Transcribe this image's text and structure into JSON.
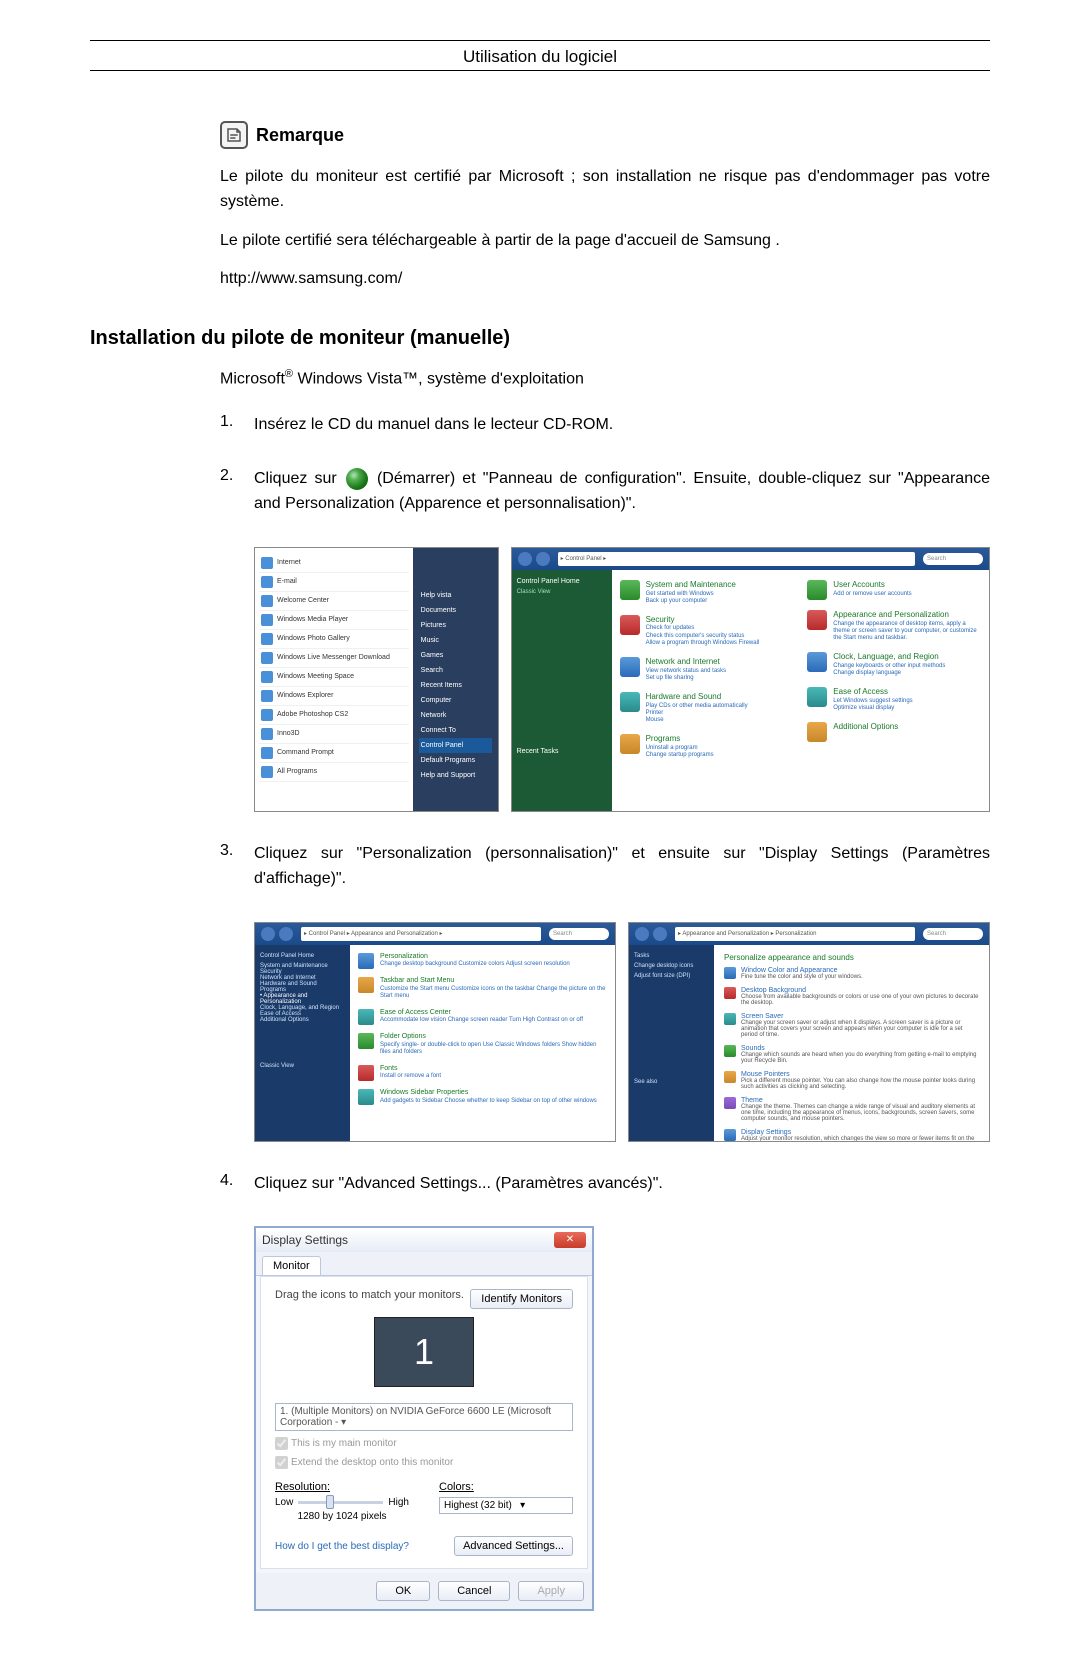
{
  "page_header": "Utilisation du logiciel",
  "remark": {
    "title": "Remarque",
    "para1": "Le pilote du moniteur est certifié par Microsoft ; son installation ne risque pas d'endommager pas votre système.",
    "para2": "Le pilote certifié sera téléchargeable à partir de la page d'accueil de Samsung .",
    "url": "http://www.samsung.com/"
  },
  "section_heading": "Installation du pilote de moniteur (manuelle)",
  "os_line_prefix": "Microsoft",
  "os_line_mid": " Windows Vista",
  "os_line_suffix": ", système d'exploitation",
  "steps": {
    "1": {
      "num": "1.",
      "text": "Insérez le CD du manuel dans le lecteur CD-ROM."
    },
    "2": {
      "num": "2.",
      "pre": "Cliquez sur",
      "post": "(Démarrer) et \"Panneau de configuration\". Ensuite, double-cliquez sur \"Appearance and Personalization (Apparence et personnalisation)\"."
    },
    "3": {
      "num": "3.",
      "text": "Cliquez sur \"Personalization (personnalisation)\" et ensuite sur \"Display Settings (Paramètres d'affichage)\"."
    },
    "4": {
      "num": "4.",
      "text": "Cliquez sur \"Advanced Settings... (Paramètres avancés)\"."
    }
  },
  "start_menu": {
    "left": [
      "Internet",
      "E-mail",
      "Welcome Center",
      "Windows Media Player",
      "Windows Photo Gallery",
      "Windows Live Messenger Download",
      "Windows Meeting Space",
      "Windows Explorer",
      "Adobe Photoshop CS2",
      "Inno3D",
      "Command Prompt",
      "All Programs"
    ],
    "right": [
      "Help vista",
      "Documents",
      "Pictures",
      "Music",
      "Games",
      "Search",
      "Recent Items",
      "Computer",
      "Network",
      "Connect To",
      "Control Panel",
      "Default Programs",
      "Help and Support"
    ]
  },
  "control_panel": {
    "breadcrumb": "▸ Control Panel ▸",
    "search_placeholder": "Search",
    "side_header": "Control Panel Home",
    "side_link": "Classic View",
    "side_recent": "Recent Tasks",
    "left_col": [
      {
        "title": "System and Maintenance",
        "subs": [
          "Get started with Windows",
          "Back up your computer"
        ]
      },
      {
        "title": "Security",
        "subs": [
          "Check for updates",
          "Check this computer's security status",
          "Allow a program through Windows Firewall"
        ]
      },
      {
        "title": "Network and Internet",
        "subs": [
          "View network status and tasks",
          "Set up file sharing"
        ]
      },
      {
        "title": "Hardware and Sound",
        "subs": [
          "Play CDs or other media automatically",
          "Printer",
          "Mouse"
        ]
      },
      {
        "title": "Programs",
        "subs": [
          "Uninstall a program",
          "Change startup programs"
        ]
      }
    ],
    "right_col": [
      {
        "title": "User Accounts",
        "subs": [
          "Add or remove user accounts"
        ]
      },
      {
        "title": "Appearance and Personalization",
        "subs": [
          "Change the appearance of desktop items, apply a theme or screen saver to your computer, or customize the Start menu and taskbar."
        ]
      },
      {
        "title": "Clock, Language, and Region",
        "subs": [
          "Change keyboards or other input methods",
          "Change display language"
        ]
      },
      {
        "title": "Ease of Access",
        "subs": [
          "Let Windows suggest settings",
          "Optimize visual display"
        ]
      },
      {
        "title": "Additional Options",
        "subs": []
      }
    ]
  },
  "appearance_panel": {
    "breadcrumb": "▸ Control Panel ▸ Appearance and Personalization ▸",
    "items": [
      {
        "title": "Personalization",
        "subs": "Change desktop background   Customize colors   Adjust screen resolution"
      },
      {
        "title": "Taskbar and Start Menu",
        "subs": "Customize the Start menu   Customize icons on the taskbar   Change the picture on the Start menu"
      },
      {
        "title": "Ease of Access Center",
        "subs": "Accommodate low vision   Change screen reader   Turn High Contrast on or off"
      },
      {
        "title": "Folder Options",
        "subs": "Specify single- or double-click to open   Use Classic Windows folders   Show hidden files and folders"
      },
      {
        "title": "Fonts",
        "subs": "Install or remove a font"
      },
      {
        "title": "Windows Sidebar Properties",
        "subs": "Add gadgets to Sidebar   Choose whether to keep Sidebar on top of other windows"
      }
    ]
  },
  "personalization_panel": {
    "breadcrumb": "▸ Appearance and Personalization ▸ Personalization",
    "side": [
      "Tasks",
      "Change desktop icons",
      "Adjust font size (DPI)"
    ],
    "heading": "Personalize appearance and sounds",
    "items": [
      {
        "title": "Window Color and Appearance",
        "sub": "Fine tune the color and style of your windows."
      },
      {
        "title": "Desktop Background",
        "sub": "Choose from available backgrounds or colors or use one of your own pictures to decorate the desktop."
      },
      {
        "title": "Screen Saver",
        "sub": "Change your screen saver or adjust when it displays. A screen saver is a picture or animation that covers your screen and appears when your computer is idle for a set period of time."
      },
      {
        "title": "Sounds",
        "sub": "Change which sounds are heard when you do everything from getting e-mail to emptying your Recycle Bin."
      },
      {
        "title": "Mouse Pointers",
        "sub": "Pick a different mouse pointer. You can also change how the mouse pointer looks during such activities as clicking and selecting."
      },
      {
        "title": "Theme",
        "sub": "Change the theme. Themes can change a wide range of visual and auditory elements at one time, including the appearance of menus, icons, backgrounds, screen savers, some computer sounds, and mouse pointers."
      },
      {
        "title": "Display Settings",
        "sub": "Adjust your monitor resolution, which changes the view so more or fewer items fit on the screen. You can also control monitor flicker (refresh rate)."
      }
    ],
    "see_also": "See also"
  },
  "display_dialog": {
    "title": "Display Settings",
    "tab": "Monitor",
    "instruction": "Drag the icons to match your monitors.",
    "identify": "Identify Monitors",
    "monitor_num": "1",
    "combo": "1. (Multiple Monitors) on NVIDIA GeForce 6600 LE (Microsoft Corporation - ▾",
    "chk1": "This is my main monitor",
    "chk2": "Extend the desktop onto this monitor",
    "resolution_label": "Resolution:",
    "low": "Low",
    "high": "High",
    "resolution_value": "1280 by 1024 pixels",
    "colors_label": "Colors:",
    "colors_value": "Highest (32 bit)",
    "help_link": "How do I get the best display?",
    "advanced": "Advanced Settings...",
    "ok": "OK",
    "cancel": "Cancel",
    "apply": "Apply"
  }
}
